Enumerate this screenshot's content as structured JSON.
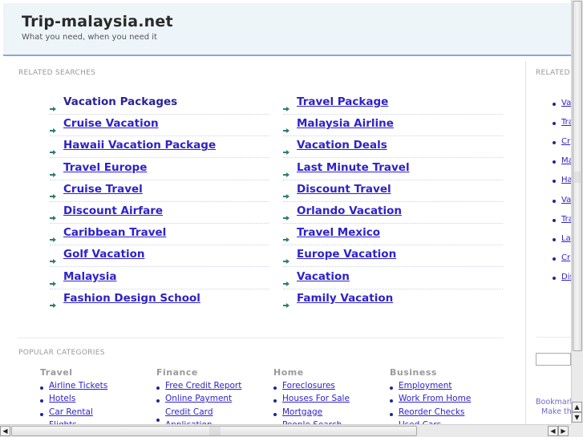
{
  "header": {
    "title": "Trip-malaysia.net",
    "tagline": "What you need, when you need it"
  },
  "related_searches": {
    "label": "RELATED SEARCHES",
    "left": [
      "Vacation Packages",
      "Cruise Vacation",
      "Hawaii Vacation Package",
      "Travel Europe",
      "Cruise Travel",
      "Discount Airfare",
      "Caribbean Travel",
      "Golf Vacation",
      "Malaysia",
      "Fashion Design School"
    ],
    "right": [
      "Travel Package",
      "Malaysia Airline",
      "Vacation Deals",
      "Last Minute Travel",
      "Discount Travel",
      "Orlando Vacation",
      "Travel Mexico",
      "Europe Vacation",
      "Vacation",
      "Family Vacation"
    ]
  },
  "popular_categories": {
    "label": "POPULAR CATEGORIES",
    "columns": [
      {
        "heading": "Travel",
        "links": [
          "Airline Tickets",
          "Hotels",
          "Car Rental",
          "Flights"
        ]
      },
      {
        "heading": "Finance",
        "links": [
          "Free Credit Report",
          "Online Payment",
          "Credit Card",
          "Application"
        ]
      },
      {
        "heading": "Home",
        "links": [
          "Foreclosures",
          "Houses For Sale",
          "Mortgage",
          "People Search"
        ]
      },
      {
        "heading": "Business",
        "links": [
          "Employment",
          "Work From Home",
          "Reorder Checks",
          "Used Cars"
        ]
      }
    ]
  },
  "sidebar": {
    "label": "RELATED",
    "links": [
      "Va",
      "Tra",
      "Cr",
      "Ma",
      "Ha",
      "Va",
      "Tra",
      "La",
      "Cr",
      "Dis"
    ],
    "bookmark_line1": "Bookmark",
    "bookmark_line2": "Make thi"
  },
  "colors": {
    "link": "#2f22c8",
    "header_bg": "#eef5f8",
    "header_border": "#8aa7d8",
    "arrow": "#2e7d6e"
  }
}
